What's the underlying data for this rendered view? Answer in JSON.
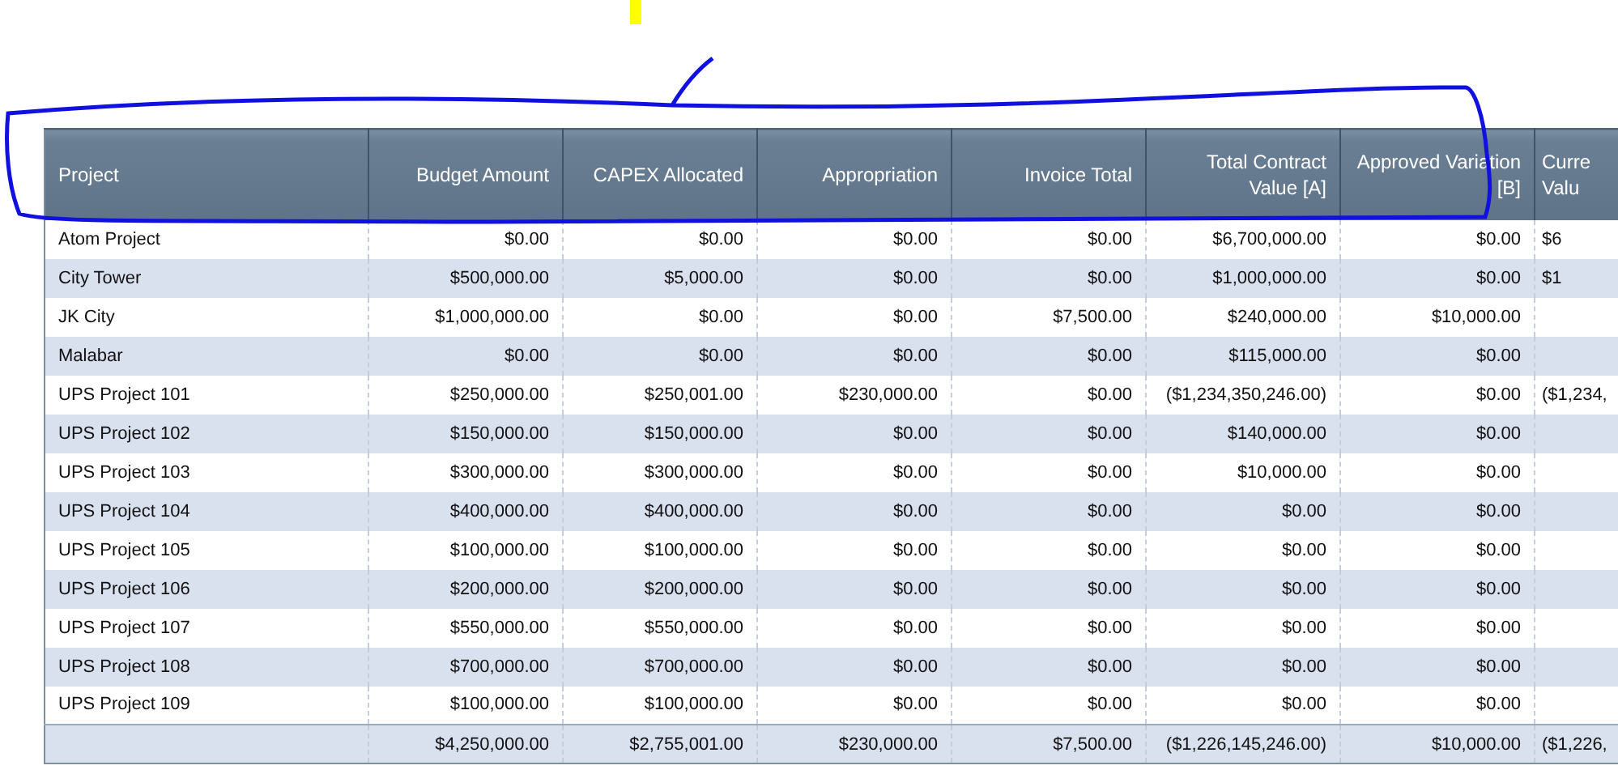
{
  "table": {
    "columns": [
      {
        "lines": [
          "Project"
        ]
      },
      {
        "lines": [
          "Budget Amount"
        ]
      },
      {
        "lines": [
          "CAPEX Allocated"
        ]
      },
      {
        "lines": [
          "Appropriation"
        ]
      },
      {
        "lines": [
          "Invoice Total"
        ]
      },
      {
        "lines": [
          "Total Contract",
          "Value [A]"
        ]
      },
      {
        "lines": [
          "Approved Variation",
          "[B]"
        ]
      },
      {
        "lines": [
          "Curre",
          "Valu"
        ]
      }
    ],
    "rows": [
      {
        "project": "Atom Project",
        "values": [
          "$0.00",
          "$0.00",
          "$0.00",
          "$0.00",
          "$6,700,000.00",
          "$0.00"
        ],
        "column_8": "$6"
      },
      {
        "project": "City Tower",
        "values": [
          "$500,000.00",
          "$5,000.00",
          "$0.00",
          "$0.00",
          "$1,000,000.00",
          "$0.00"
        ],
        "column_8": "$1"
      },
      {
        "project": "JK City",
        "values": [
          "$1,000,000.00",
          "$0.00",
          "$0.00",
          "$7,500.00",
          "$240,000.00",
          "$10,000.00"
        ]
      },
      {
        "project": "Malabar",
        "values": [
          "$0.00",
          "$0.00",
          "$0.00",
          "$0.00",
          "$115,000.00",
          "$0.00"
        ]
      },
      {
        "project": "UPS Project 101",
        "values": [
          "$250,000.00",
          "$250,001.00",
          "$230,000.00",
          "$0.00",
          "($1,234,350,246.00)",
          "$0.00"
        ],
        "column_8": "($1,234,"
      },
      {
        "project": "UPS Project 102",
        "values": [
          "$150,000.00",
          "$150,000.00",
          "$0.00",
          "$0.00",
          "$140,000.00",
          "$0.00"
        ]
      },
      {
        "project": "UPS Project 103",
        "values": [
          "$300,000.00",
          "$300,000.00",
          "$0.00",
          "$0.00",
          "$10,000.00",
          "$0.00"
        ]
      },
      {
        "project": "UPS Project 104",
        "values": [
          "$400,000.00",
          "$400,000.00",
          "$0.00",
          "$0.00",
          "$0.00",
          "$0.00"
        ]
      },
      {
        "project": "UPS Project 105",
        "values": [
          "$100,000.00",
          "$100,000.00",
          "$0.00",
          "$0.00",
          "$0.00",
          "$0.00"
        ]
      },
      {
        "project": "UPS Project 106",
        "values": [
          "$200,000.00",
          "$200,000.00",
          "$0.00",
          "$0.00",
          "$0.00",
          "$0.00"
        ]
      },
      {
        "project": "UPS Project 107",
        "values": [
          "$550,000.00",
          "$550,000.00",
          "$0.00",
          "$0.00",
          "$0.00",
          "$0.00"
        ]
      },
      {
        "project": "UPS Project 108",
        "values": [
          "$700,000.00",
          "$700,000.00",
          "$0.00",
          "$0.00",
          "$0.00",
          "$0.00"
        ]
      },
      {
        "project": "UPS Project 109",
        "values": [
          "$100,000.00",
          "$100,000.00",
          "$0.00",
          "$0.00",
          "$0.00",
          "$0.00"
        ]
      }
    ],
    "totals": {
      "values": [
        "$4,250,000.00",
        "$2,755,001.00",
        "$230,000.00",
        "$7,500.00",
        "($1,226,145,246.00)",
        "$10,000.00"
      ],
      "column_8": "($1,226,"
    }
  }
}
